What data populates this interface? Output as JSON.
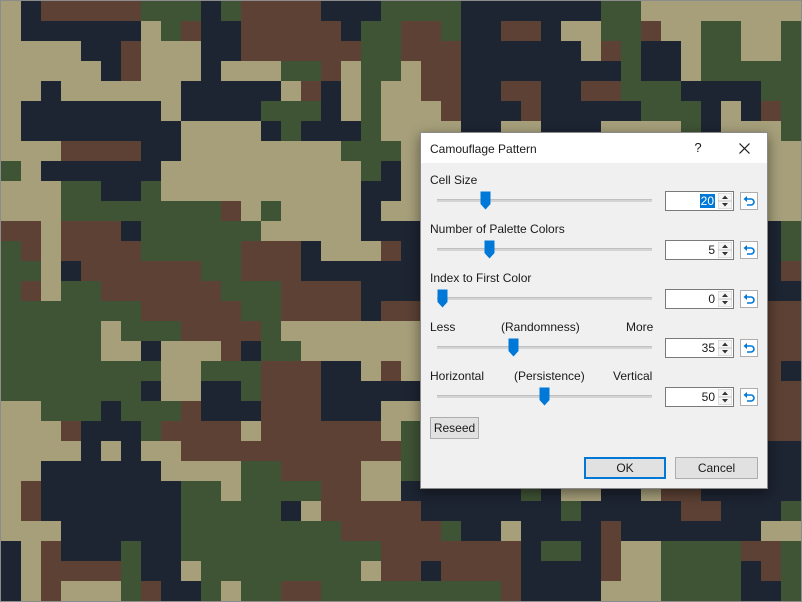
{
  "background": {
    "palette": [
      "#3f5335",
      "#a69f7a",
      "#5c4134",
      "#1d2432"
    ],
    "cells_per_row": 40,
    "cells_per_column": 30
  },
  "dialog": {
    "title": "Camouflage Pattern",
    "help_glyph": "?",
    "controls": [
      {
        "label": "Cell Size",
        "value": "20",
        "level": 0.21,
        "selected": true
      },
      {
        "label": "Number of Palette Colors",
        "value": "5",
        "level": 0.23
      },
      {
        "label": "Index to First Color",
        "value": "0",
        "level": 0.0
      },
      {
        "label_left": "Less",
        "label_center": "(Randomness)",
        "label_right": "More",
        "value": "35",
        "level": 0.35
      },
      {
        "label_left": "Horizontal",
        "label_center": "(Persistence)",
        "label_right": "Vertical",
        "value": "50",
        "level": 0.5
      }
    ],
    "reseed_label": "Reseed",
    "ok_label": "OK",
    "cancel_label": "Cancel",
    "accent_color": "#0078d7"
  }
}
